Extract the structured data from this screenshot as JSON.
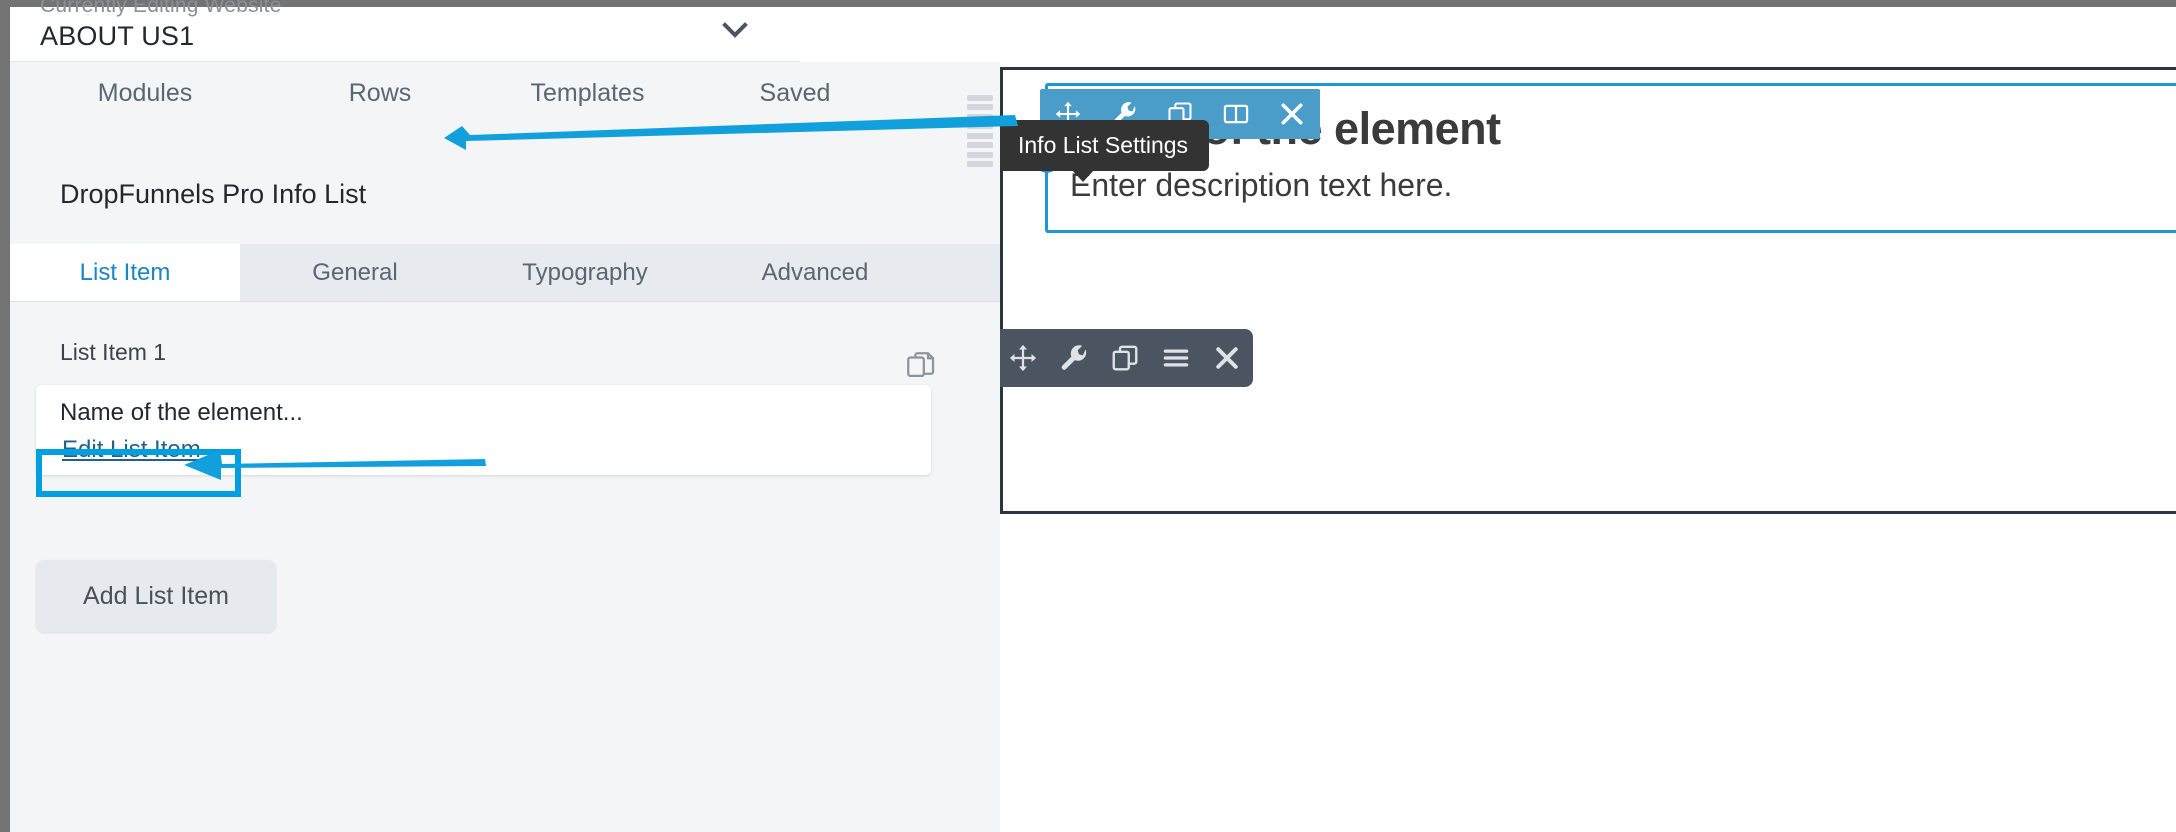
{
  "panel": {
    "header": {
      "subtitle": "Currently Editing Website",
      "title": "ABOUT US1",
      "chevron_icon": "chevron-down-icon"
    },
    "nav_tabs": [
      {
        "label": "Modules"
      },
      {
        "label": "Rows"
      },
      {
        "label": "Templates"
      },
      {
        "label": "Saved"
      }
    ],
    "module_title": "DropFunnels Pro Info List",
    "sub_tabs": [
      {
        "label": "List Item",
        "active": true
      },
      {
        "label": "General",
        "active": false
      },
      {
        "label": "Typography",
        "active": false
      },
      {
        "label": "Advanced",
        "active": false
      }
    ],
    "list_section": {
      "item_label": "List Item 1",
      "duplicate_icon": "copy-icon",
      "card": {
        "name": "Name of the element...",
        "edit_link": "Edit List Item"
      },
      "add_button": "Add List Item"
    },
    "resize_handle_icon": "drag-handle-icon"
  },
  "canvas": {
    "module": {
      "heading": "Name of the element",
      "description": "Enter description text here.",
      "tooltip": "Info List Settings",
      "toolbar_buttons": [
        {
          "icon": "move-icon",
          "name": "move-module-button"
        },
        {
          "icon": "wrench-icon",
          "name": "module-settings-button"
        },
        {
          "icon": "duplicate-icon",
          "name": "duplicate-module-button"
        },
        {
          "icon": "columns-icon",
          "name": "module-columns-button"
        },
        {
          "icon": "close-icon",
          "name": "remove-module-button"
        }
      ]
    },
    "row": {
      "toolbar_buttons": [
        {
          "icon": "move-icon",
          "name": "move-row-button"
        },
        {
          "icon": "wrench-icon",
          "name": "row-settings-button"
        },
        {
          "icon": "duplicate-icon",
          "name": "duplicate-row-button"
        },
        {
          "icon": "menu-icon",
          "name": "row-menu-button"
        },
        {
          "icon": "close-icon",
          "name": "remove-row-button"
        }
      ]
    }
  },
  "annotations": {
    "accent_color": "#00a0e0",
    "arrows": [
      {
        "name": "arrow-pointing-to-module-title"
      },
      {
        "name": "arrow-pointing-to-edit-list-item"
      }
    ],
    "highlight": {
      "name": "edit-list-item-highlight",
      "color": "#00a0e0"
    }
  },
  "colors": {
    "panel_bg": "#f4f5f7",
    "tab_active": "#1a87c4",
    "module_toolbar": "#4a9dc8",
    "row_toolbar": "#4b5562",
    "selection_blue": "#2196d6",
    "row_outline": "#2b3440"
  }
}
